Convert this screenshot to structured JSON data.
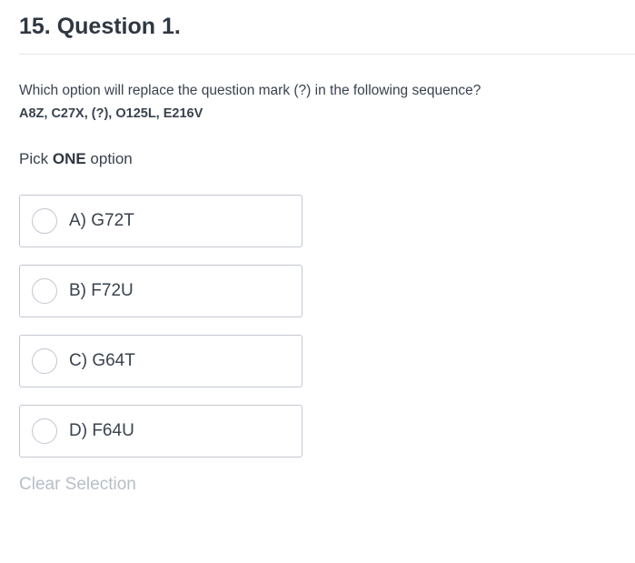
{
  "header": {
    "title": "15. Question 1."
  },
  "question": {
    "text": "Which option will replace the question mark (?) in the following sequence?",
    "sequence": "A8Z, C27X, (?), O125L, E216V"
  },
  "instruction": {
    "prefix": "Pick ",
    "emphasis": "ONE",
    "suffix": " option"
  },
  "options": [
    {
      "label": "A) G72T",
      "selected": false
    },
    {
      "label": "B) F72U",
      "selected": false
    },
    {
      "label": "C) G64T",
      "selected": false
    },
    {
      "label": "D) F64U",
      "selected": false
    }
  ],
  "actions": {
    "clear_label": "Clear Selection"
  },
  "colors": {
    "text": "#39424e",
    "title": "#2f3742",
    "border": "#c2c7d0",
    "muted": "#b7bec7"
  }
}
